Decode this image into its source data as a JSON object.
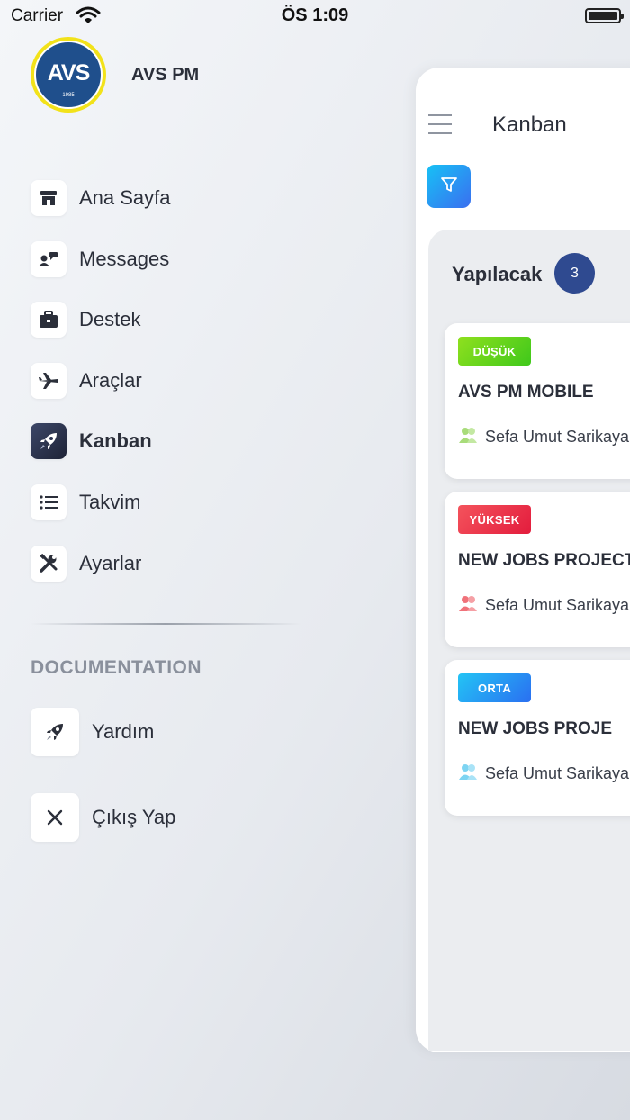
{
  "status_bar": {
    "carrier": "Carrier",
    "time": "ÖS 1:09"
  },
  "brand": {
    "logo_text": "AVS",
    "logo_year": "1985",
    "app_name": "AVS PM"
  },
  "menu": {
    "items": [
      {
        "label": "Ana Sayfa",
        "icon": "store-icon"
      },
      {
        "label": "Messages",
        "icon": "user-message-icon"
      },
      {
        "label": "Destek",
        "icon": "briefcase-icon"
      },
      {
        "label": "Araçlar",
        "icon": "airplane-icon"
      },
      {
        "label": "Kanban",
        "icon": "rocket-icon",
        "active": true
      },
      {
        "label": "Takvim",
        "icon": "list-icon"
      },
      {
        "label": "Ayarlar",
        "icon": "tools-icon"
      }
    ]
  },
  "documentation": {
    "heading": "DOCUMENTATION",
    "items": [
      {
        "label": "Yardım",
        "icon": "rocket-icon"
      },
      {
        "label": "Çıkış Yap",
        "icon": "close-icon"
      }
    ]
  },
  "kanban": {
    "title": "Kanban",
    "column": {
      "title": "Yapılacak",
      "count": "3",
      "cards": [
        {
          "priority": "DÜŞÜK",
          "priority_color": "#52cc1c",
          "title": "AVS PM MOBILE",
          "user": "Sefa Umut Sarikaya",
          "user_icon_color": "#a8dc7a"
        },
        {
          "priority": "YÜKSEK",
          "priority_color": "#e8283f",
          "title": "NEW JOBS PROJECT",
          "user": "Sefa Umut Sarikaya",
          "user_icon_color": "#f0727a"
        },
        {
          "priority": "ORTA",
          "priority_color": "#2a8ef2",
          "title": "NEW JOBS PROJE",
          "user": "Sefa Umut Sarikaya",
          "user_icon_color": "#7dd4f2"
        }
      ]
    }
  },
  "colors": {
    "accent": "#2f4a90",
    "logo_ring": "#f2e21a",
    "logo_fill": "#1f4f8c"
  }
}
